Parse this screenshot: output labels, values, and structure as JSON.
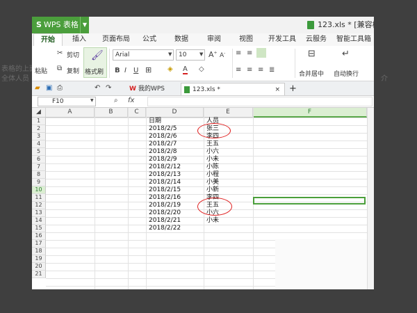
{
  "background_text": [
    "表格的上面",
    "全体人员",
    "介"
  ],
  "app": {
    "name": "WPS 表格",
    "logo_glyph": "S",
    "title": "123.xls * [兼容模式] -",
    "accent_color": "#4b9e3c"
  },
  "ribbon_tabs": [
    "开始",
    "插入",
    "页面布局",
    "公式",
    "数据",
    "审阅",
    "视图",
    "开发工具",
    "云服务",
    "智能工具箱"
  ],
  "ribbon": {
    "cut": "剪切",
    "paste": "粘贴",
    "copy": "复制",
    "format_painter": "格式刷",
    "font_name": "Arial",
    "font_size": "10",
    "merge_center": "合并居中",
    "wrap_text": "自动换行"
  },
  "doc_tabs": {
    "home": "我的WPS",
    "file": "123.xls *",
    "add": "+"
  },
  "formula_bar": {
    "name_box": "F10",
    "fx": "fx",
    "value": ""
  },
  "columns": [
    "A",
    "B",
    "C",
    "D",
    "E",
    "F"
  ],
  "selected_column": "F",
  "selected_row": 10,
  "rows": [
    "1",
    "2",
    "3",
    "4",
    "5",
    "6",
    "7",
    "8",
    "9",
    "10",
    "11",
    "12",
    "13",
    "14",
    "15",
    "16",
    "17",
    "18",
    "19",
    "20",
    "21"
  ],
  "sheet": {
    "D": [
      "日期",
      "2018/2/5",
      "2018/2/6",
      "2018/2/7",
      "2018/2/8",
      "2018/2/9",
      "2018/2/12",
      "2018/2/13",
      "2018/2/14",
      "2018/2/15",
      "2018/2/16",
      "2018/2/19",
      "2018/2/20",
      "2018/2/21",
      "2018/2/22"
    ],
    "E": [
      "人员",
      "张三",
      "李四",
      "王五",
      "小六",
      "小未",
      "小陈",
      "小程",
      "小美",
      "小新",
      "李四",
      "王五",
      "小六",
      "小未"
    ]
  },
  "annotation_color": "#e02020"
}
